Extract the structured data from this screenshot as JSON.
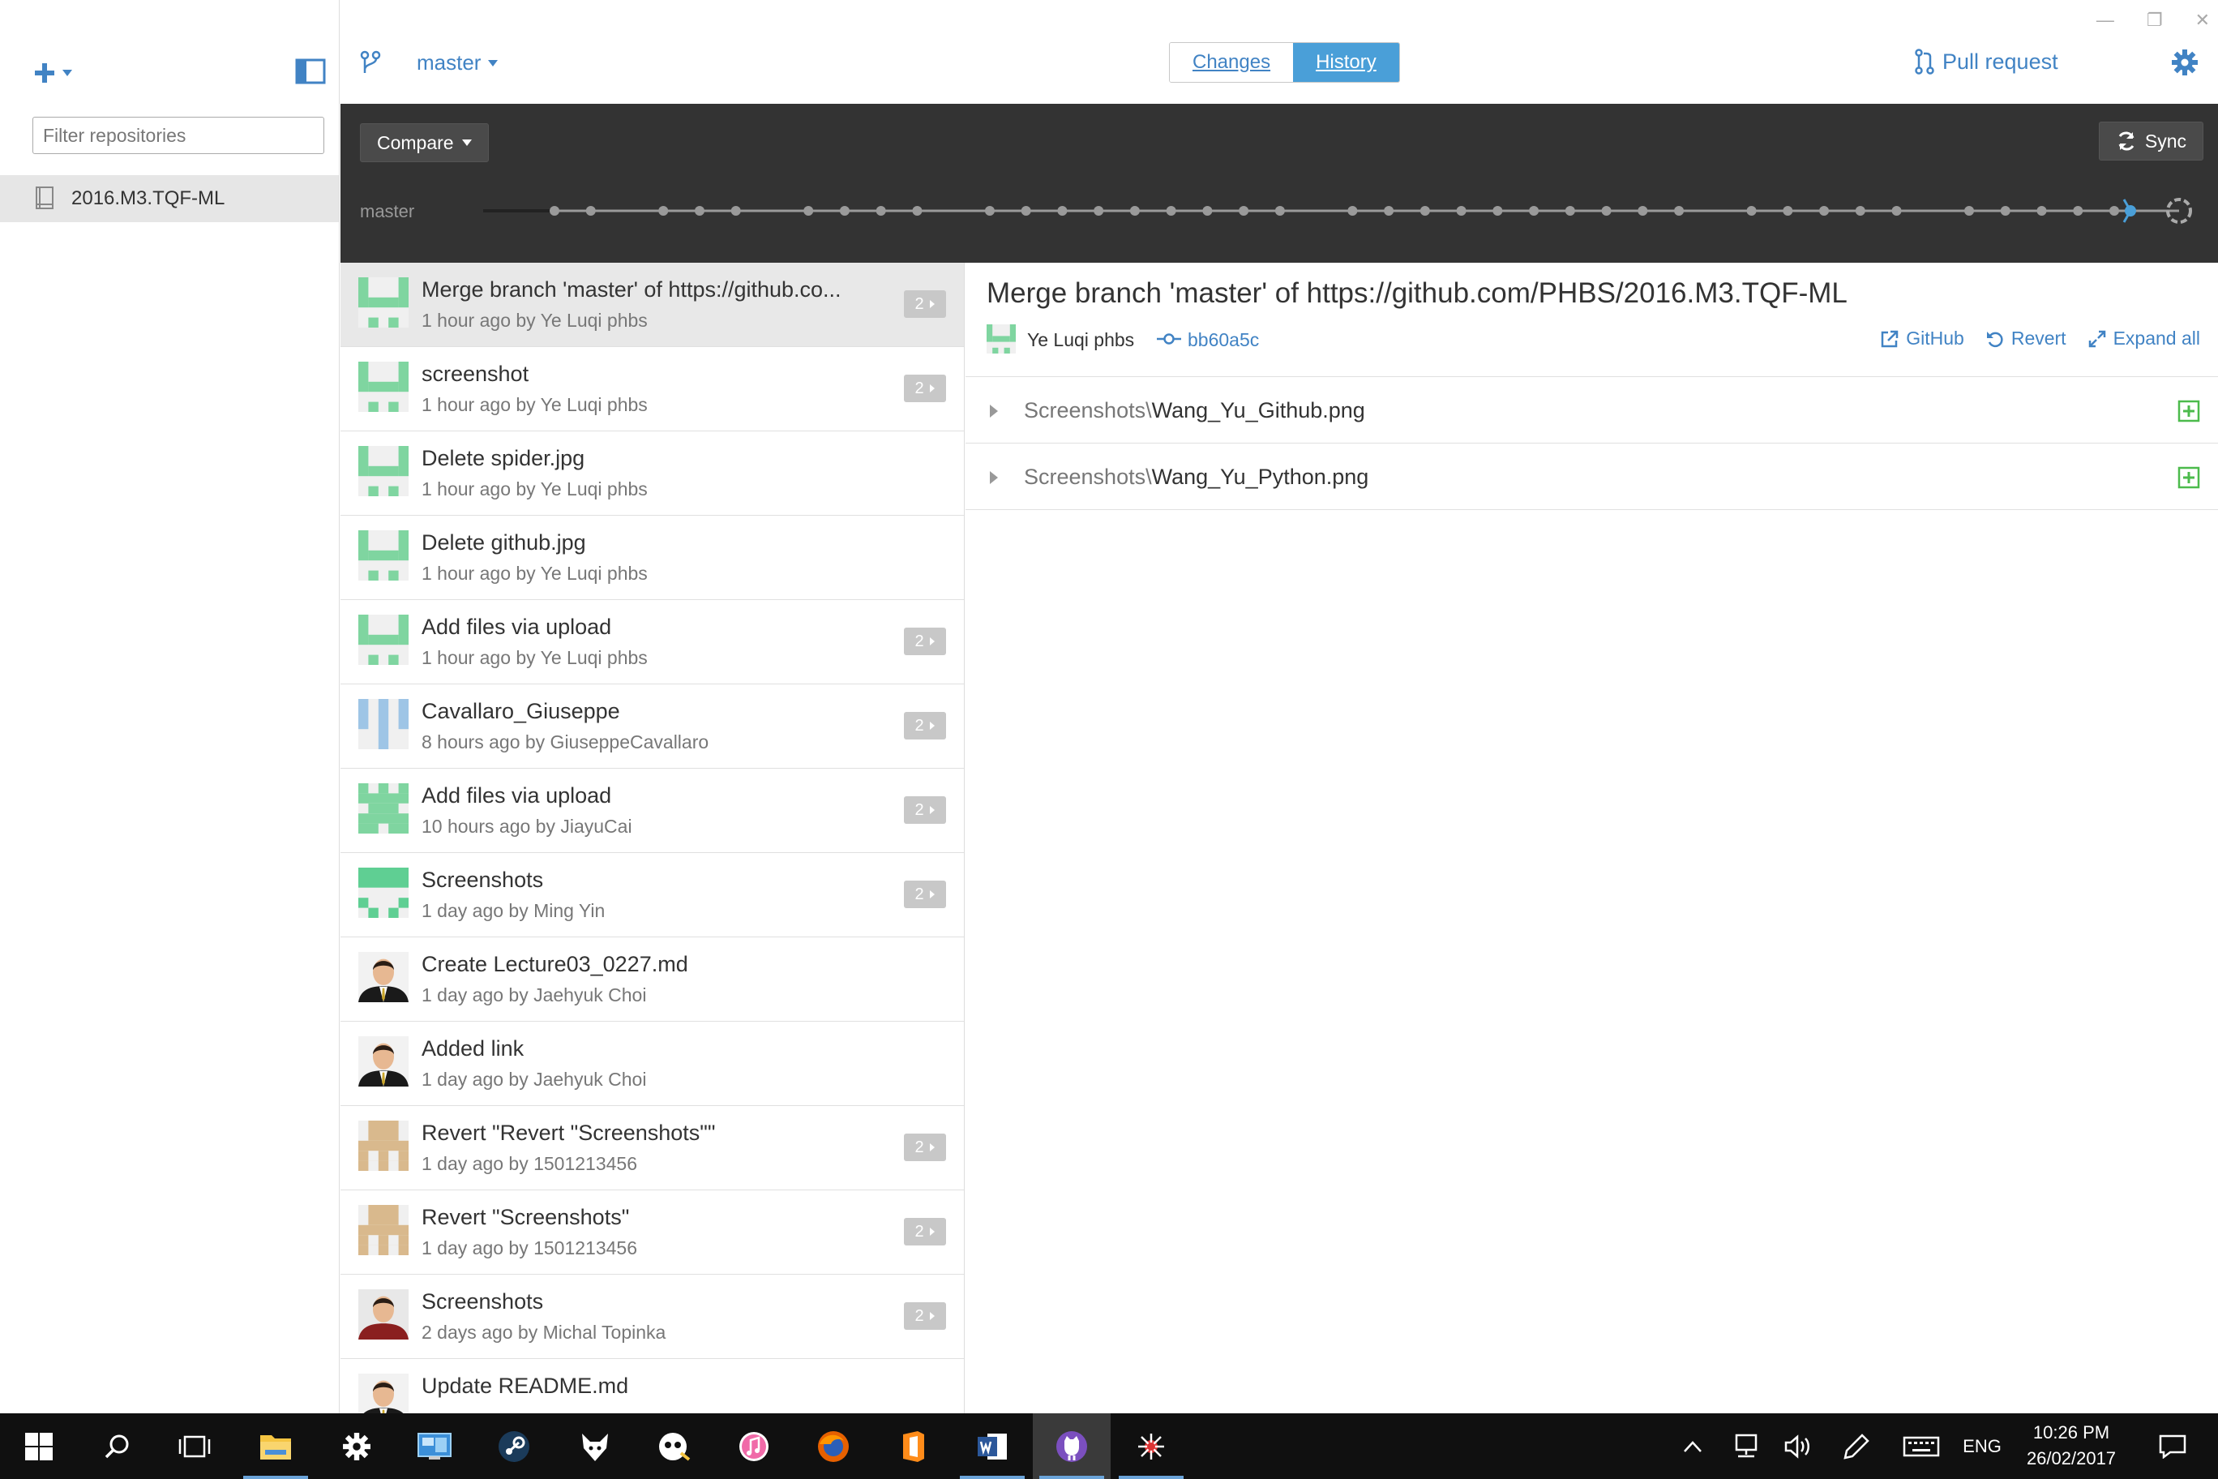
{
  "sidebar": {
    "filter_placeholder": "Filter repositories",
    "repositories": [
      {
        "name": "2016.M3.TQF-ML",
        "selected": true
      }
    ]
  },
  "toolbar": {
    "branch": "master",
    "tabs": [
      {
        "label": "Changes",
        "active": false
      },
      {
        "label": "History",
        "active": true
      }
    ],
    "pull_request_label": "Pull request"
  },
  "timeline": {
    "compare_label": "Compare",
    "sync_label": "Sync",
    "branch_label": "master",
    "commit_dot_count": 38
  },
  "commits": [
    {
      "title": "Merge branch 'master' of https://github.co...",
      "meta": "1 hour ago by Ye Luqi phbs",
      "files": "2",
      "avatar": "identicon-green-a",
      "selected": true
    },
    {
      "title": "screenshot",
      "meta": "1 hour ago by Ye Luqi phbs",
      "files": "2",
      "avatar": "identicon-green-a",
      "selected": false
    },
    {
      "title": "Delete spider.jpg",
      "meta": "1 hour ago by Ye Luqi phbs",
      "files": "",
      "avatar": "identicon-green-a",
      "selected": false
    },
    {
      "title": "Delete github.jpg",
      "meta": "1 hour ago by Ye Luqi phbs",
      "files": "",
      "avatar": "identicon-green-a",
      "selected": false
    },
    {
      "title": "Add files via upload",
      "meta": "1 hour ago by Ye Luqi phbs",
      "files": "2",
      "avatar": "identicon-green-a",
      "selected": false
    },
    {
      "title": "Cavallaro_Giuseppe",
      "meta": "8 hours ago by GiuseppeCavallaro",
      "files": "2",
      "avatar": "identicon-blue",
      "selected": false
    },
    {
      "title": "Add files via upload",
      "meta": "10 hours ago by JiayuCai",
      "files": "2",
      "avatar": "identicon-green-b",
      "selected": false
    },
    {
      "title": "Screenshots",
      "meta": "1 day ago by Ming Yin",
      "files": "2",
      "avatar": "identicon-teal",
      "selected": false
    },
    {
      "title": "Create Lecture03_0227.md",
      "meta": "1 day ago by Jaehyuk Choi",
      "files": "",
      "avatar": "photo-man-suit",
      "selected": false
    },
    {
      "title": "Added link",
      "meta": "1 day ago by Jaehyuk Choi",
      "files": "",
      "avatar": "photo-man-suit",
      "selected": false
    },
    {
      "title": "Revert \"Revert \"Screenshots\"\"",
      "meta": "1 day ago by 1501213456",
      "files": "2",
      "avatar": "identicon-tan",
      "selected": false
    },
    {
      "title": "Revert \"Screenshots\"",
      "meta": "1 day ago by 1501213456",
      "files": "2",
      "avatar": "identicon-tan",
      "selected": false
    },
    {
      "title": "Screenshots",
      "meta": "2 days ago by Michal Topinka",
      "files": "2",
      "avatar": "photo-man-casual",
      "selected": false
    },
    {
      "title": "Update README.md",
      "meta": "",
      "files": "",
      "avatar": "photo-man-suit",
      "selected": false
    }
  ],
  "detail": {
    "title": "Merge branch 'master' of https://github.com/PHBS/2016.M3.TQF-ML",
    "author": "Ye Luqi phbs",
    "sha": "bb60a5c",
    "actions": {
      "github": "GitHub",
      "revert": "Revert",
      "expand": "Expand all"
    },
    "files": [
      {
        "dir": "Screenshots\\",
        "name": "Wang_Yu_Github.png",
        "status": "added"
      },
      {
        "dir": "Screenshots\\",
        "name": "Wang_Yu_Python.png",
        "status": "added"
      }
    ]
  },
  "taskbar": {
    "apps": [
      "start-icon",
      "search-icon",
      "task-view-icon",
      "file-explorer-icon",
      "settings-icon",
      "remote-desktop-icon",
      "steam-icon",
      "fox-app-icon",
      "mascot-app-icon",
      "itunes-icon",
      "firefox-icon",
      "office-icon",
      "word-icon",
      "github-desktop-icon",
      "spider-app-icon"
    ],
    "language": "ENG",
    "time": "10:26 PM",
    "date": "26/02/2017"
  },
  "colors": {
    "accent": "#4183c4",
    "history_tab": "#4a9fd8",
    "band": "#333333",
    "added": "#4cbb4c",
    "identicon_green": "#7fd5a0",
    "identicon_blue": "#9ec5e6",
    "identicon_tan": "#d9b98d"
  }
}
